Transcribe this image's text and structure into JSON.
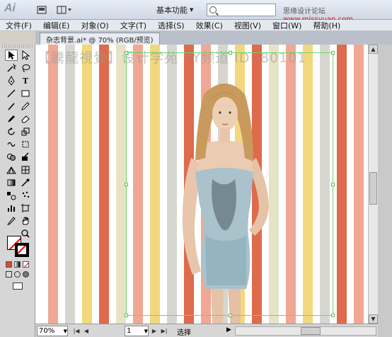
{
  "app": {
    "logo": "Ai",
    "workspace": "基本功能",
    "workspace_arrow": "▼",
    "watermark_prefix": "思缘设计论坛",
    "watermark_url": "www.missyuan.com"
  },
  "menu": [
    "文件(F)",
    "编辑(E)",
    "对象(O)",
    "文字(T)",
    "选择(S)",
    "效果(C)",
    "视图(V)",
    "窗口(W)",
    "帮助(H)"
  ],
  "document": {
    "tab_title": "杂志背景.ai* @ 70% (RGB/预览)",
    "canvas_watermark": "【騰龍視覺】设计学苑 YY频道 ID: 80101"
  },
  "status": {
    "zoom": "70%",
    "page": "1",
    "tool_label": "选择"
  },
  "colors": {
    "stripe_salmon": "#f0a894",
    "stripe_yellow": "#f2d77e",
    "stripe_red": "#dd6b4c",
    "stripe_pale": "#e7e2c6",
    "stripe_grey": "#d6d6cf",
    "selection_green": "#6bd86b"
  },
  "icons": {
    "tool_1": "selection-arrow-icon",
    "tool_2": "direct-selection-icon"
  }
}
